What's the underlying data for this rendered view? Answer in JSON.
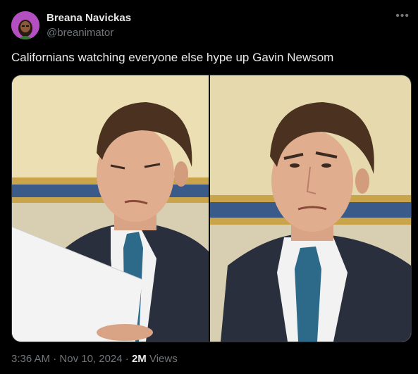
{
  "author": {
    "name": "Breana Navickas",
    "handle": "@breanimator"
  },
  "more_icon": "•••",
  "tweet": {
    "text": "Californians watching everyone else hype up Gavin Newsom"
  },
  "meta": {
    "time": "3:36 AM",
    "sep1": " · ",
    "date": "Nov 10, 2024",
    "sep2": " · ",
    "views_count": "2M",
    "views_label": " Views"
  },
  "colors": {
    "text": "#e7e9ea",
    "secondary": "#71767b",
    "background": "#000000",
    "avatar_bg": "#b44fc1"
  },
  "icons": [
    "more-icon",
    "avatar-image",
    "media-photo"
  ]
}
